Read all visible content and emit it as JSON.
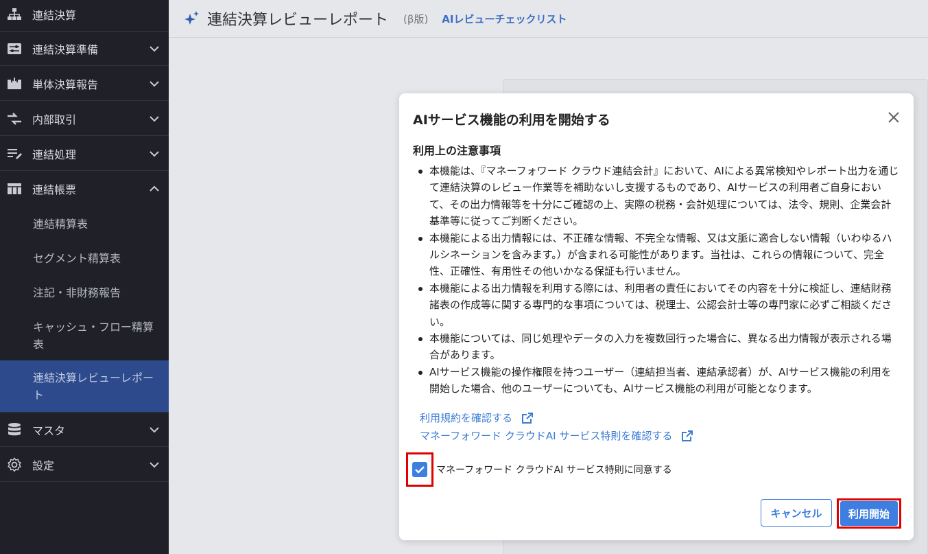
{
  "sidebar": {
    "items": [
      {
        "label": "連結決算",
        "icon": "org-chart-icon"
      },
      {
        "label": "連結決算準備",
        "icon": "sliders-icon"
      },
      {
        "label": "単体決算報告",
        "icon": "inbox-icon"
      },
      {
        "label": "内部取引",
        "icon": "arrows-exchange-icon"
      },
      {
        "label": "連結処理",
        "icon": "list-edit-icon"
      },
      {
        "label": "連結帳票",
        "icon": "table-icon"
      },
      {
        "label": "マスタ",
        "icon": "database-icon"
      },
      {
        "label": "設定",
        "icon": "gear-icon"
      }
    ],
    "subitems": [
      {
        "label": "連結精算表"
      },
      {
        "label": "セグメント精算表"
      },
      {
        "label": "注記・非財務報告"
      },
      {
        "label": "キャッシュ・フロー精算表"
      },
      {
        "label": "連結決算レビューレポート"
      }
    ]
  },
  "header": {
    "title": "連結決算レビューレポート",
    "beta": "(β版)",
    "link": "AIレビューチェックリスト"
  },
  "modal": {
    "title": "AIサービス機能の利用を開始する",
    "notes_title": "利用上の注意事項",
    "notes": [
      "本機能は、『マネーフォワード クラウド連結会計』において、AIによる異常検知やレポート出力を通じて連結決算のレビュー作業等を補助ないし支援するものであり、AIサービスの利用者ご自身において、その出力情報等を十分にご確認の上、実際の税務・会計処理については、法令、規則、企業会計基準等に従ってご判断ください。",
      "本機能による出力情報には、不正確な情報、不完全な情報、又は文脈に適合しない情報（いわゆるハルシネーションを含みます。）が含まれる可能性があります。当社は、これらの情報について、完全性、正確性、有用性その他いかなる保証も行いません。",
      "本機能による出力情報を利用する際には、利用者の責任においてその内容を十分に検証し、連結財務諸表の作成等に関する専門的な事項については、税理士、公認会計士等の専門家に必ずご相談ください。",
      "本機能については、同じ処理やデータの入力を複数回行った場合に、異なる出力情報が表示される場合があります。",
      "AIサービス機能の操作権限を持つユーザー（連結担当者、連結承認者）が、AIサービス機能の利用を開始した場合、他のユーザーについても、AIサービス機能の利用が可能となります。"
    ],
    "link_terms": "利用規約を確認する",
    "link_special": "マネーフォワード クラウドAI サービス特則を確認する",
    "agree_label": "マネーフォワード クラウドAI サービス特則に同意する",
    "agree_checked": true,
    "cancel_label": "キャンセル",
    "start_label": "利用開始"
  },
  "colors": {
    "accent": "#3d7ee0",
    "sidebar_bg": "#202128",
    "sidebar_active": "#2d4a8c",
    "highlight": "#e00000"
  }
}
